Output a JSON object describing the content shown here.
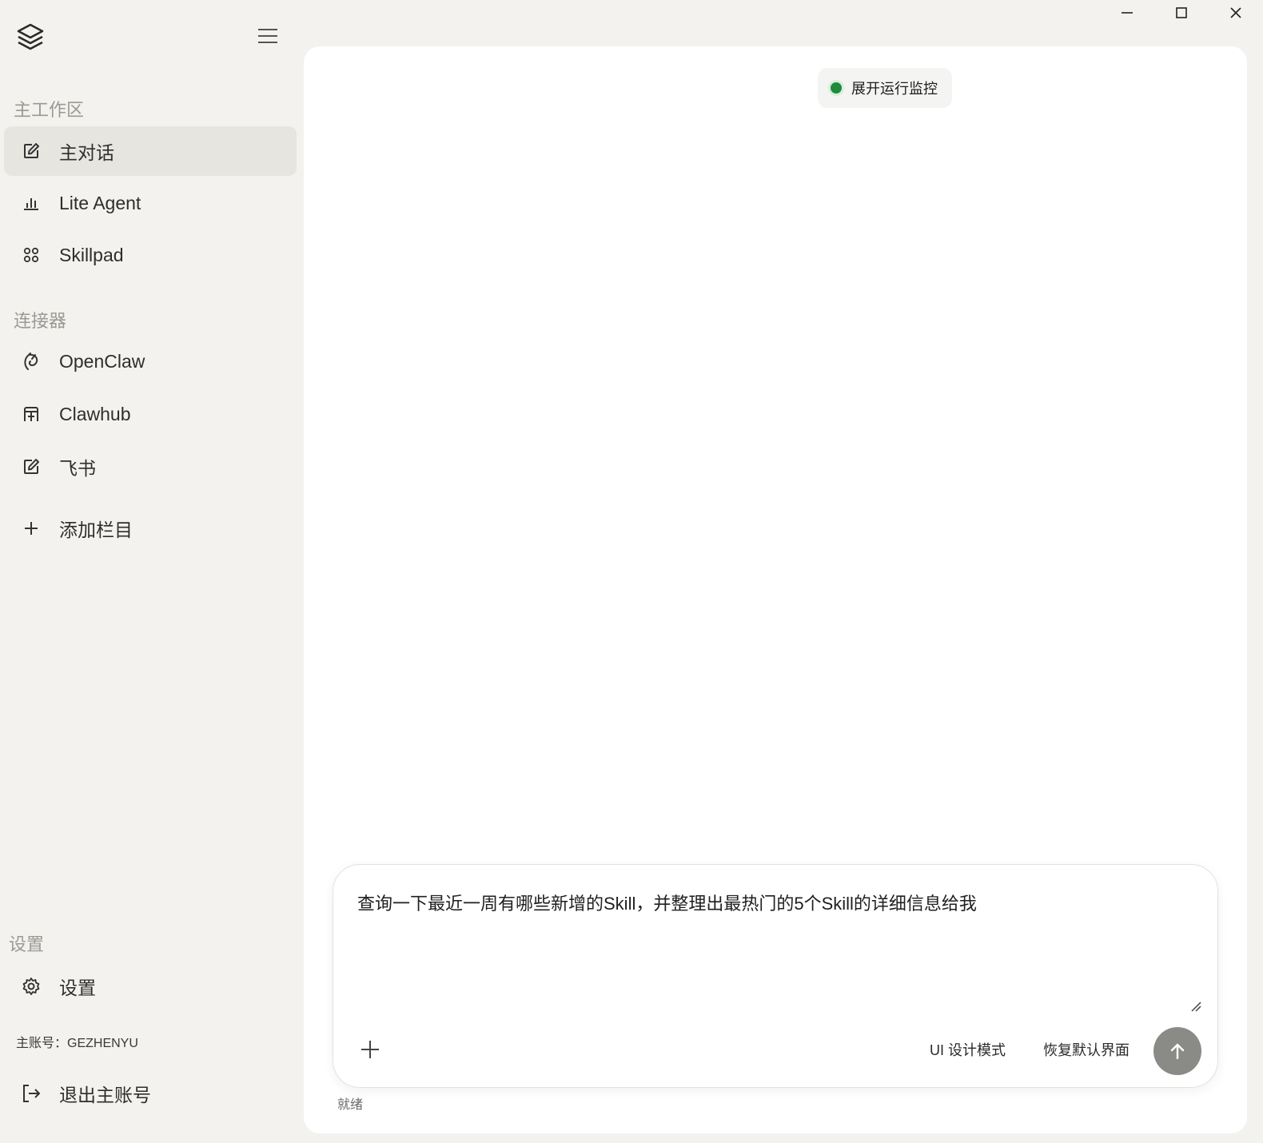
{
  "window": {
    "controls": [
      "minimize",
      "maximize",
      "close"
    ]
  },
  "sidebar": {
    "sections": {
      "workspace": "主工作区",
      "connectors": "连接器",
      "settings": "设置"
    },
    "workspace_items": [
      {
        "label": "主对话",
        "icon": "edit-icon",
        "active": true
      },
      {
        "label": "Lite Agent",
        "icon": "bar-chart-icon",
        "active": false
      },
      {
        "label": "Skillpad",
        "icon": "grid-dots-icon",
        "active": false
      }
    ],
    "connector_items": [
      {
        "label": "OpenClaw",
        "icon": "claw-icon"
      },
      {
        "label": "Clawhub",
        "icon": "hub-icon"
      },
      {
        "label": "飞书",
        "icon": "edit-icon"
      }
    ],
    "add_item": {
      "label": "添加栏目",
      "icon": "plus-icon"
    },
    "settings_item": {
      "label": "设置",
      "icon": "gear-icon"
    },
    "account": "主账号：GEZHENYU",
    "logout": {
      "label": "退出主账号",
      "icon": "logout-icon"
    }
  },
  "main": {
    "monitor_label": "展开运行监控",
    "monitor_status_color": "#1f8a3c",
    "composer": {
      "value": "查询一下最近一周有哪些新增的Skill，并整理出最热门的5个Skill的详细信息给我",
      "ui_design_mode": "UI 设计模式",
      "restore_default": "恢复默认界面"
    },
    "status": "就绪"
  }
}
